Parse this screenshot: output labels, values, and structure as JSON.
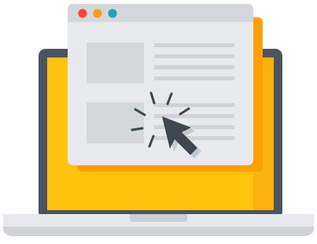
{
  "illustration": {
    "subject": "laptop-with-browser-window-and-click-cursor",
    "colors": {
      "background": "#ffffff",
      "laptop_bezel": "#4b5460",
      "screen_fill": "#ffc20e",
      "screen_shadow": "#f5a50b",
      "window_shadow": "#ff9f00",
      "window_body": "#e8e9ec",
      "window_titlebar": "#d4d7dc",
      "image_placeholder": "#d4d7dc",
      "text_line": "#cfd3d9",
      "traffic_red": "#f5473b",
      "traffic_orange": "#ff9d11",
      "traffic_teal": "#1ea3b7",
      "cursor": "#3f4650",
      "base_top": "#e6e8eb",
      "base_bottom": "#cfd3d8",
      "notch": "#cbcfd4"
    },
    "icons": {
      "window_controls": [
        "close-dot",
        "minimize-dot",
        "maximize-dot"
      ],
      "pointer": "cursor-arrow-icon",
      "click_effect": "click-burst-icon"
    }
  }
}
